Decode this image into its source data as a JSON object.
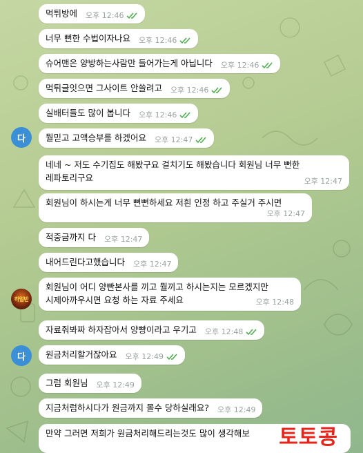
{
  "watermark": "토토콩",
  "avatars": {
    "da_label": "다",
    "bettor_label": "하얼빈"
  },
  "messages": [
    {
      "text": "먹튀방에",
      "time": "오후 12:46",
      "read": true
    },
    {
      "text": "너무 뻔한 수법이자나요",
      "time": "오후 12:46",
      "read": true
    },
    {
      "text": "슈어맨은 양방하는사람만 들어가는게 아닙니다",
      "time": "오후 12:46",
      "read": true
    },
    {
      "text": "먹튀글잇으면 그사이트 안쓸려고",
      "time": "오후 12:46",
      "read": true
    },
    {
      "text": "실배터들도 많이 봅니다",
      "time": "오후 12:46",
      "read": true
    },
    {
      "text": "뭘믿고 고액승부를 하겠어요",
      "time": "오후 12:47",
      "read": true
    },
    {
      "text": "네네 ~ 저도 수기집도 해봤구요 걸치기도 해봤습니다 회원님 너무 뻔한\n레파토리구요",
      "time": "오후 12:47",
      "read": false
    },
    {
      "text": "회원님이 하시는게 너무 뻔뻔하세요 저흰 인정 하고 주실거 주시면",
      "time": "오후 12:47",
      "read": false
    },
    {
      "text": "적중금까지 다",
      "time": "오후 12:47",
      "read": false
    },
    {
      "text": "내어드린다고했습니다",
      "time": "오후 12:47",
      "read": false
    },
    {
      "text": "회원님이 어디 양빤본사를 끼고 뭘끼고 하시는지는 모르겠지만\n시제아까우시면 요청 하는 자료 주세요",
      "time": "오후 12:48",
      "read": false
    },
    {
      "text": "자료줘봐짜 하자잡아서 양빵이라고 우기고",
      "time": "오후 12:48",
      "read": true
    },
    {
      "text": "원금처리할거잖아요",
      "time": "오후 12:49",
      "read": true
    },
    {
      "text": "그럼 회원님",
      "time": "오후 12:49",
      "read": false
    },
    {
      "text": "지금처럼하시다가 원금까지 몰수 당하실래요?",
      "time": "오후 12:49",
      "read": false
    },
    {
      "text": "만약 그러면 저희가 원금처리해드리는것도 많이 생각해보",
      "time": "",
      "read": false
    }
  ]
}
